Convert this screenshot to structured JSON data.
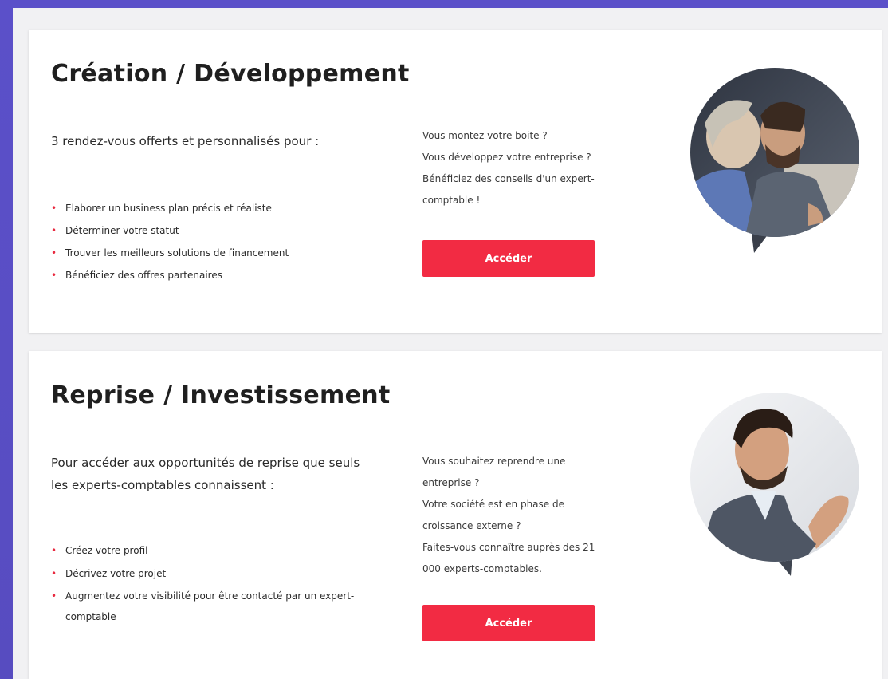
{
  "cards": [
    {
      "title": "Création / Développement",
      "intro": "3 rendez-vous offerts et personnalisés pour :",
      "bullets": [
        "Elaborer un business plan précis et réaliste",
        "Déterminer votre statut",
        "Trouver les meilleurs solutions de financement",
        "Bénéficiez des offres partenaires"
      ],
      "side_lines": [
        "Vous montez votre boite ?",
        "Vous développez votre entreprise ?",
        "Bénéficiez des conseils d'un expert-",
        "comptable !"
      ],
      "button_label": "Accéder",
      "image_icon": "two-people-photo-icon"
    },
    {
      "title": "Reprise / Investissement",
      "intro": "Pour accéder aux opportunités de reprise que seuls les experts-comptables connaissent :",
      "bullets": [
        "Créez votre profil",
        "Décrivez votre projet",
        "Augmentez votre visibilité pour être contacté par un expert-comptable"
      ],
      "side_lines": [
        "Vous souhaitez reprendre une",
        "entreprise ?",
        "Votre société est en phase de",
        "croissance externe ?",
        "Faites-vous connaître auprès des 21",
        "000 experts-comptables."
      ],
      "button_label": "Accéder",
      "image_icon": "businessman-photo-icon"
    }
  ],
  "colors": {
    "accent": "#f22b43",
    "background": "#5a4fc4",
    "panel": "#f1f1f3",
    "card": "#ffffff"
  }
}
